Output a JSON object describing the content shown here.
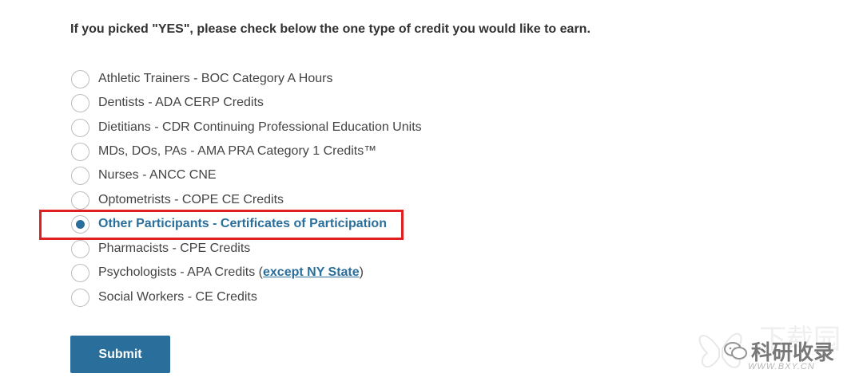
{
  "question": "If you picked \"YES\", please check below the one type of credit you would like to earn.",
  "options": [
    {
      "label": "Athletic Trainers - BOC Category A Hours",
      "checked": false
    },
    {
      "label": "Dentists - ADA CERP Credits",
      "checked": false
    },
    {
      "label": "Dietitians - CDR Continuing Professional Education Units",
      "checked": false
    },
    {
      "label": "MDs, DOs, PAs - AMA PRA Category 1 Credits™",
      "checked": false
    },
    {
      "label": "Nurses - ANCC CNE",
      "checked": false
    },
    {
      "label": "Optometrists - COPE CE Credits",
      "checked": false
    },
    {
      "label": "Other Participants - Certificates of Participation",
      "checked": true
    },
    {
      "label": "Pharmacists - CPE Credits",
      "checked": false
    },
    {
      "label": "Psychologists - APA Credits (",
      "checked": false,
      "link": "except NY State",
      "suffix": ")"
    },
    {
      "label": "Social Workers - CE Credits",
      "checked": false
    }
  ],
  "submit_label": "Submit",
  "watermark": {
    "text": "科研收录",
    "url": "WWW.BXY.CN",
    "bg_text": "下载园"
  },
  "colors": {
    "accent": "#2a6f9b",
    "highlight": "#e02020"
  }
}
